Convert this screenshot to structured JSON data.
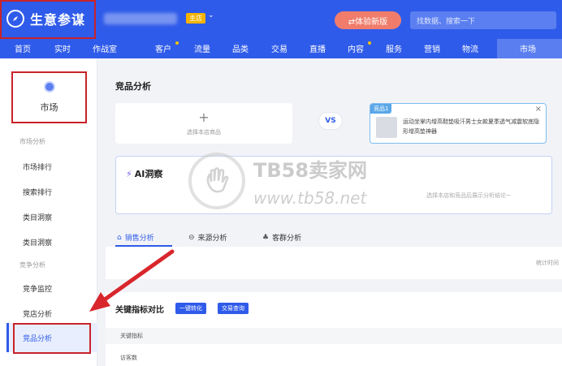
{
  "app": {
    "title": "生意参谋",
    "store_badge": "主店",
    "try_button": "⇄体验新版",
    "search_placeholder": "找数据、搜索一下"
  },
  "nav": {
    "items": [
      {
        "label": "首页",
        "dot": false
      },
      {
        "label": "实时",
        "dot": false
      },
      {
        "label": "作战室",
        "dot": false
      },
      {
        "label": "客户",
        "dot": true
      },
      {
        "label": "流量",
        "dot": false
      },
      {
        "label": "品类",
        "dot": false
      },
      {
        "label": "交易",
        "dot": false
      },
      {
        "label": "直播",
        "dot": false
      },
      {
        "label": "内容",
        "dot": true
      },
      {
        "label": "服务",
        "dot": false
      },
      {
        "label": "营销",
        "dot": false
      },
      {
        "label": "物流",
        "dot": false
      },
      {
        "label": "市场",
        "dot": false
      }
    ],
    "active": "市场"
  },
  "sidebar": {
    "section_title": "市场",
    "group1": "市场分析",
    "group1_items": [
      "市场排行",
      "搜索排行",
      "类目洞察",
      "类目洞察"
    ],
    "group2": "竞争分析",
    "group2_items": [
      "竞争监控",
      "竞店分析",
      "竞品分析"
    ],
    "active_item": "竞品分析"
  },
  "main": {
    "title": "竞品分析",
    "add_plus": "+",
    "add_label": "选择本店商品",
    "vs": "VS",
    "competitor": {
      "tag": "竞品1",
      "close": "×",
      "text": "运动坐掌内增高鞋垫吸汗男士女款夏季透气减震软底隐形增高垫神器"
    },
    "ai": {
      "title": "AI洞察",
      "hint": "选择本店和竞品后展示分析结论~"
    },
    "tabs": [
      {
        "label": "销售分析",
        "icon": "chart-icon"
      },
      {
        "label": "来源分析",
        "icon": "source-icon"
      },
      {
        "label": "客群分析",
        "icon": "people-icon"
      }
    ],
    "stat_time": "统计时间",
    "kpi": {
      "title": "关键指标对比",
      "btn1": "一键转化",
      "btn2": "交易查询",
      "col_header": "关键指标",
      "row1": "访客数"
    }
  },
  "watermark": {
    "title": "TB58卖家网",
    "url": "www.tb58.net"
  },
  "colors": {
    "brand_blue": "#2f5bea",
    "highlight_red": "#c8232a",
    "try_button": "#f07d6b"
  }
}
